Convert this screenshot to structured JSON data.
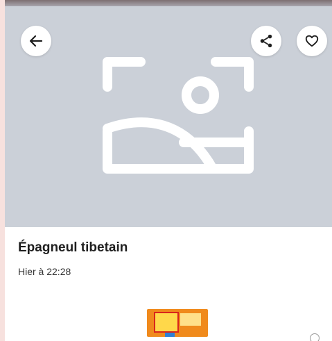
{
  "listing": {
    "title": "Épagneul tibetain",
    "posted": "Hier à 22:28"
  },
  "icons": {
    "back": "arrow-left-icon",
    "share": "share-icon",
    "favorite": "heart-icon",
    "placeholder": "image-placeholder-icon"
  },
  "colors": {
    "hero_background": "#cbd0d8",
    "page_background": "#f7e1de",
    "icon_dark": "#1f1f1f"
  }
}
